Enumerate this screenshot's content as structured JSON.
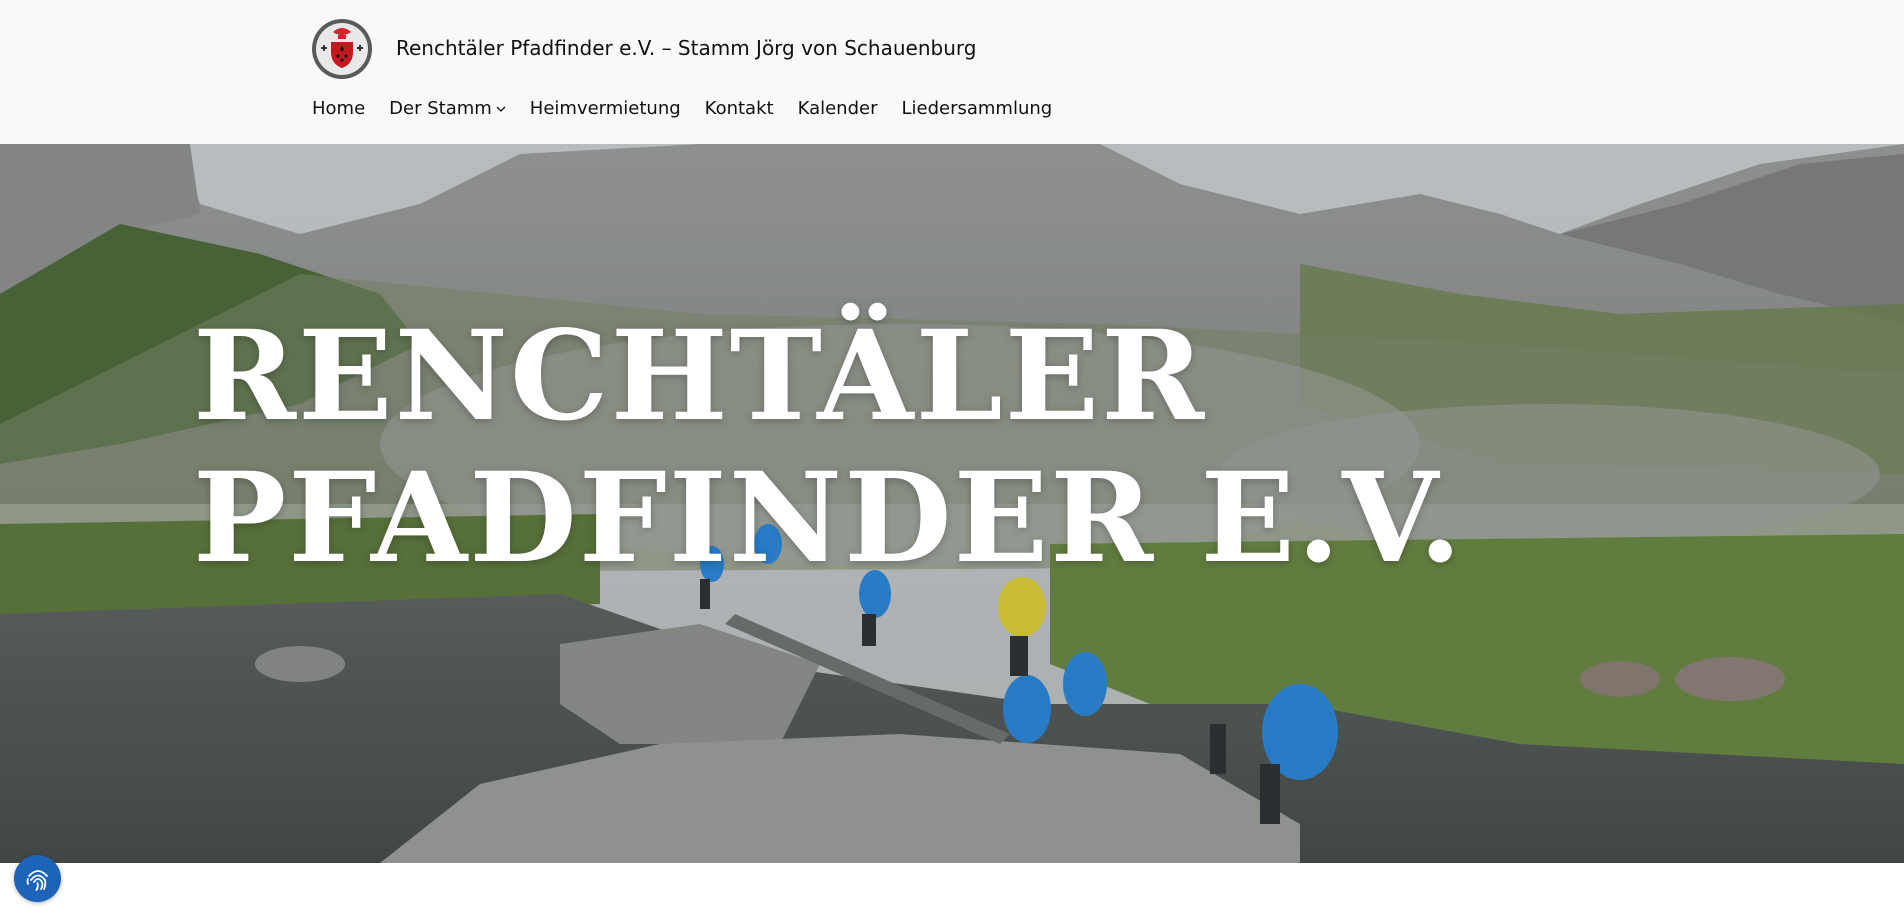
{
  "site": {
    "title": "Renchtäler Pfadfinder e.V. – Stamm Jörg von Schauenburg"
  },
  "nav": {
    "items": [
      {
        "label": "Home"
      },
      {
        "label": "Der Stamm",
        "has_submenu": true
      },
      {
        "label": "Heimvermietung"
      },
      {
        "label": "Kontakt"
      },
      {
        "label": "Kalender"
      },
      {
        "label": "Liedersammlung"
      }
    ]
  },
  "hero": {
    "title_line1": "RENCHTÄLER",
    "title_line2": "PFADFINDER E.V."
  },
  "icons": {
    "logo": "scout-crest-logo",
    "submenu": "chevron-down-icon",
    "cookie": "fingerprint-icon"
  },
  "colors": {
    "header_bg": "#f9f9f9",
    "cookie_button": "#1d63b8",
    "hero_text": "#ffffff"
  }
}
